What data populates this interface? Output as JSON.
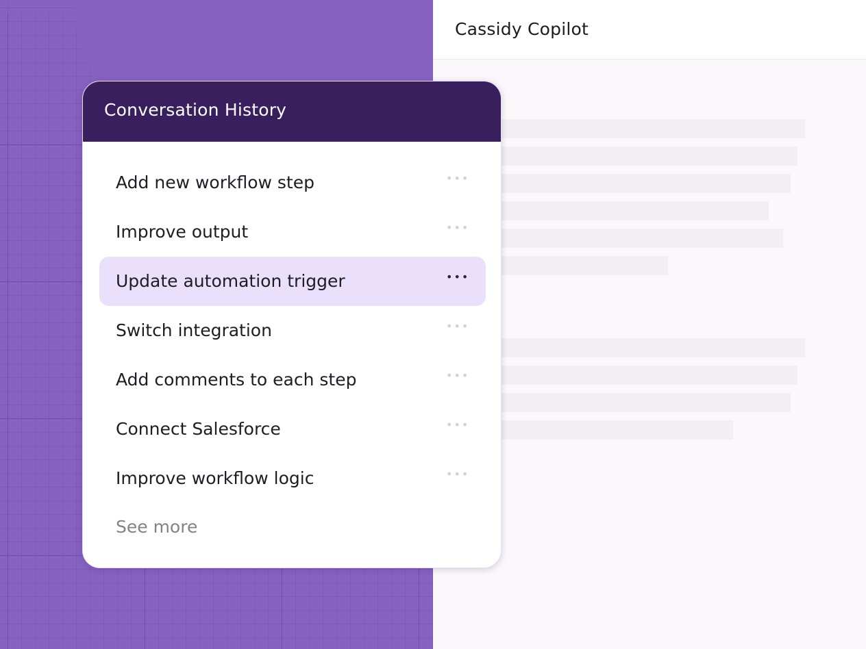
{
  "app": {
    "title": "Cassidy Copilot"
  },
  "history": {
    "title": "Conversation History",
    "items": [
      {
        "label": "Add new workflow step",
        "active": false
      },
      {
        "label": "Improve output",
        "active": false
      },
      {
        "label": "Update automation trigger",
        "active": true
      },
      {
        "label": "Switch integration",
        "active": false
      },
      {
        "label": "Add comments to each step",
        "active": false
      },
      {
        "label": "Connect Salesforce",
        "active": false
      },
      {
        "label": "Improve workflow logic",
        "active": false
      }
    ],
    "more_icon": "ellipsis-icon",
    "see_more": "See more"
  },
  "colors": {
    "background_purple": "#8762c0",
    "header_purple": "#391f5e",
    "active_item": "#ebe0fc",
    "skeleton": "#f1eff3"
  }
}
